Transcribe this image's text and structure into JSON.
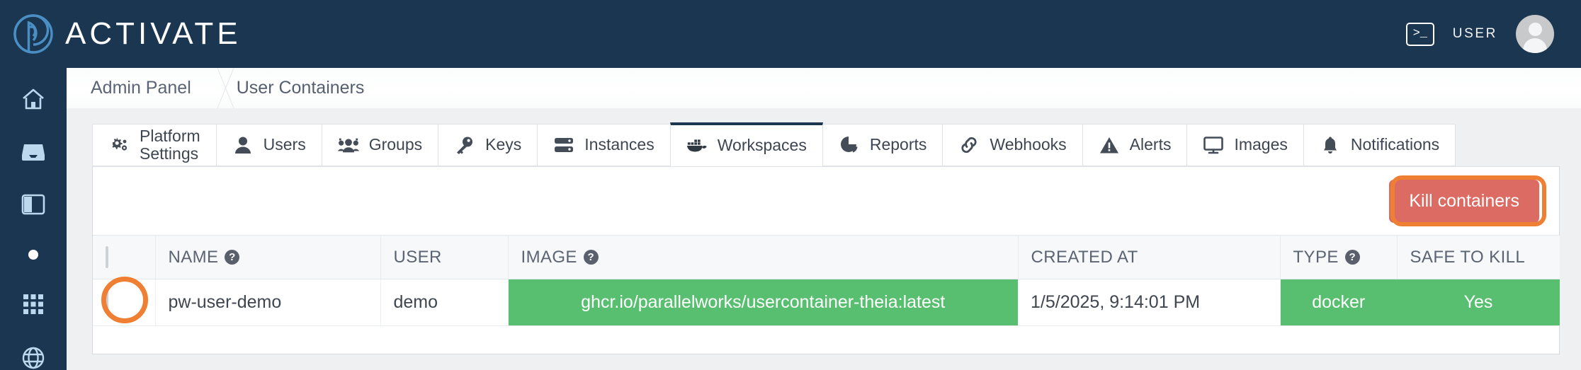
{
  "brand": {
    "name": "ACTIVATE",
    "logo_icon": "activate-spiral-p-logo"
  },
  "topbar": {
    "terminal_icon": "terminal-icon",
    "terminal_glyph": ">_",
    "user_label": "USER",
    "avatar_icon": "user-avatar"
  },
  "sidebar": {
    "items": [
      {
        "name": "home",
        "icon": "home-icon"
      },
      {
        "name": "inbox",
        "icon": "inbox-icon"
      },
      {
        "name": "panel",
        "icon": "sidebar-panel-icon"
      },
      {
        "name": "status-dot",
        "icon": "dot-icon"
      },
      {
        "name": "apps",
        "icon": "grid-apps-icon"
      },
      {
        "name": "globe",
        "icon": "globe-icon"
      }
    ]
  },
  "breadcrumb": {
    "items": [
      "Admin Panel",
      "User Containers"
    ],
    "separator_icon": "chevron-separator-icon"
  },
  "tabs": [
    {
      "label": "Platform\nSettings",
      "label_line1": "Platform",
      "label_line2": "Settings",
      "icon": "cogs-icon",
      "active": false
    },
    {
      "label": "Users",
      "icon": "user-icon",
      "active": false
    },
    {
      "label": "Groups",
      "icon": "users-group-icon",
      "active": false
    },
    {
      "label": "Keys",
      "icon": "key-icon",
      "active": false
    },
    {
      "label": "Instances",
      "icon": "server-icon",
      "active": false
    },
    {
      "label": "Workspaces",
      "icon": "docker-whale-icon",
      "active": true
    },
    {
      "label": "Reports",
      "icon": "pie-chart-icon",
      "active": false
    },
    {
      "label": "Webhooks",
      "icon": "link-chain-icon",
      "active": false
    },
    {
      "label": "Alerts",
      "icon": "warning-triangle-icon",
      "active": false
    },
    {
      "label": "Images",
      "icon": "monitor-icon",
      "active": false
    },
    {
      "label": "Notifications",
      "icon": "bell-icon",
      "active": false
    }
  ],
  "toolbar": {
    "kill_containers_label": "Kill containers"
  },
  "table": {
    "headers": [
      {
        "label": "",
        "help": false
      },
      {
        "label": "NAME",
        "help": true
      },
      {
        "label": "USER",
        "help": false
      },
      {
        "label": "IMAGE",
        "help": true
      },
      {
        "label": "CREATED AT",
        "help": false
      },
      {
        "label": "TYPE",
        "help": true
      },
      {
        "label": "SAFE TO KILL",
        "help": false
      }
    ],
    "help_glyph": "?",
    "rows": [
      {
        "name": "pw-user-demo",
        "user": "demo",
        "image": "ghcr.io/parallelworks/usercontainer-theia:latest",
        "created_at": "1/5/2025, 9:14:01 PM",
        "type": "docker",
        "safe_to_kill": "Yes"
      }
    ]
  },
  "annotations": {
    "highlight_color": "#ee7f33",
    "targets": [
      "kill-containers-button",
      "row-select-checkbox"
    ]
  },
  "colors": {
    "navy": "#1b3650",
    "logo_blue": "#4a8fc4",
    "danger": "#dc6b63",
    "green": "#57bf6f",
    "page_bg": "#eef0f2"
  }
}
